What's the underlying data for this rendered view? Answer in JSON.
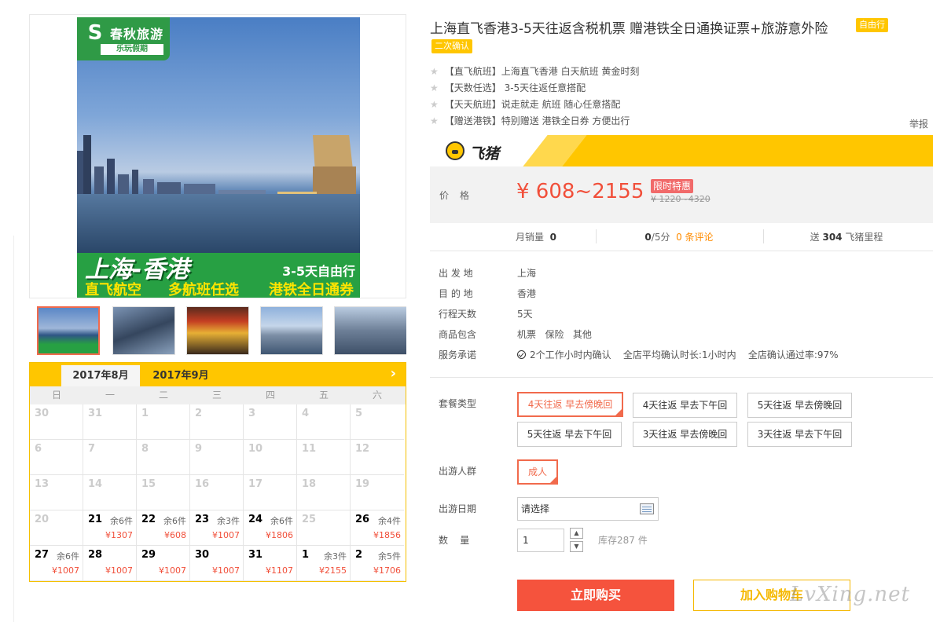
{
  "gallery": {
    "logo": {
      "name": "春秋旅游",
      "sub": "乐玩假期",
      "mark": "S"
    },
    "banner": {
      "title": "上海-香港",
      "days": "3-5天自由行",
      "feature1": "直飞航空",
      "feature2": "多航班任选",
      "feature3": "港铁全日通券"
    },
    "thumbnails": [
      {
        "name": "thumb-1",
        "active": true
      },
      {
        "name": "thumb-2",
        "active": false
      },
      {
        "name": "thumb-3",
        "active": false
      },
      {
        "name": "thumb-4",
        "active": false
      },
      {
        "name": "thumb-5",
        "active": false
      }
    ]
  },
  "calendar": {
    "tabs": [
      "2017年8月",
      "2017年9月"
    ],
    "next_icon": "chevron-right-icon",
    "weekdays": [
      "日",
      "一",
      "二",
      "三",
      "四",
      "五",
      "六"
    ],
    "rows": [
      [
        {
          "d": "30"
        },
        {
          "d": "31"
        },
        {
          "d": "1"
        },
        {
          "d": "2"
        },
        {
          "d": "3"
        },
        {
          "d": "4"
        },
        {
          "d": "5"
        }
      ],
      [
        {
          "d": "6"
        },
        {
          "d": "7"
        },
        {
          "d": "8"
        },
        {
          "d": "9"
        },
        {
          "d": "10"
        },
        {
          "d": "11"
        },
        {
          "d": "12"
        }
      ],
      [
        {
          "d": "13"
        },
        {
          "d": "14"
        },
        {
          "d": "15"
        },
        {
          "d": "16"
        },
        {
          "d": "17"
        },
        {
          "d": "18"
        },
        {
          "d": "19"
        }
      ],
      [
        {
          "d": "20"
        },
        {
          "d": "21",
          "stock": "余6件",
          "price": "¥1307"
        },
        {
          "d": "22",
          "stock": "余6件",
          "price": "¥608"
        },
        {
          "d": "23",
          "stock": "余3件",
          "price": "¥1007"
        },
        {
          "d": "24",
          "stock": "余6件",
          "price": "¥1806"
        },
        {
          "d": "25"
        },
        {
          "d": "26",
          "stock": "余4件",
          "price": "¥1856"
        }
      ],
      [
        {
          "d": "27",
          "stock": "余6件",
          "price": "¥1007"
        },
        {
          "d": "28",
          "price": "¥1007"
        },
        {
          "d": "29",
          "price": "¥1007"
        },
        {
          "d": "30",
          "price": "¥1007"
        },
        {
          "d": "31",
          "price": "¥1107"
        },
        {
          "d": "1",
          "stock": "余3件",
          "price": "¥2155"
        },
        {
          "d": "2",
          "stock": "余5件",
          "price": "¥1706"
        }
      ]
    ]
  },
  "product": {
    "title": "上海直飞香港3-5天往返含税机票 赠港铁全日通换证票+旅游意外险",
    "tag1": "自由行",
    "tag2": "二次确认",
    "features": [
      "【直飞航班】上海直飞香港 白天航班 黄金时刻",
      "【天数任选】 3-5天往返任意搭配",
      "【天天航班】说走就走 航班 随心任意搭配",
      "【赠送港铁】特别赠送 港铁全日券 方便出行"
    ],
    "report": "举报",
    "platform": "飞猪",
    "price_label": "价格",
    "price": "¥ 608~2155",
    "price_badge": "限时特惠",
    "price_old": "¥ 1220~4320",
    "stats": {
      "monthly_label": "月销量",
      "monthly_value": "0",
      "rating_value": "0",
      "rating_suffix": "/5分",
      "reviews": "0 条评论",
      "points_prefix": "送",
      "points_value": "304",
      "points_suffix": "飞猪里程"
    },
    "info": [
      {
        "k": "出 发 地",
        "v": "上海"
      },
      {
        "k": "目 的 地",
        "v": "香港"
      },
      {
        "k": "行程天数",
        "v": "5天"
      },
      {
        "k": "商品包含",
        "v": "机票   保险   其他"
      }
    ],
    "service": {
      "k": "服务承诺",
      "v1": "2个工作小时内确认",
      "v2": "全店平均确认时长:1小时内",
      "v3": "全店确认通过率:97%"
    }
  },
  "options": {
    "package_label": "套餐类型",
    "packages": [
      "4天往返 早去傍晚回",
      "4天往返 早去下午回",
      "5天往返 早去傍晚回",
      "5天往返 早去下午回",
      "3天往返 早去傍晚回",
      "3天往返 早去下午回"
    ],
    "people_label": "出游人群",
    "people": "成人",
    "date_label": "出游日期",
    "date_placeholder": "请选择",
    "qty_label": "数    量",
    "qty_value": "1",
    "stock": "库存287 件",
    "buy": "立即购买",
    "cart": "加入购物车",
    "watermark": "LvXing.net"
  },
  "colors": {
    "accent": "#f5533d",
    "brand_yellow": "#ffc600",
    "green": "#27a043"
  }
}
